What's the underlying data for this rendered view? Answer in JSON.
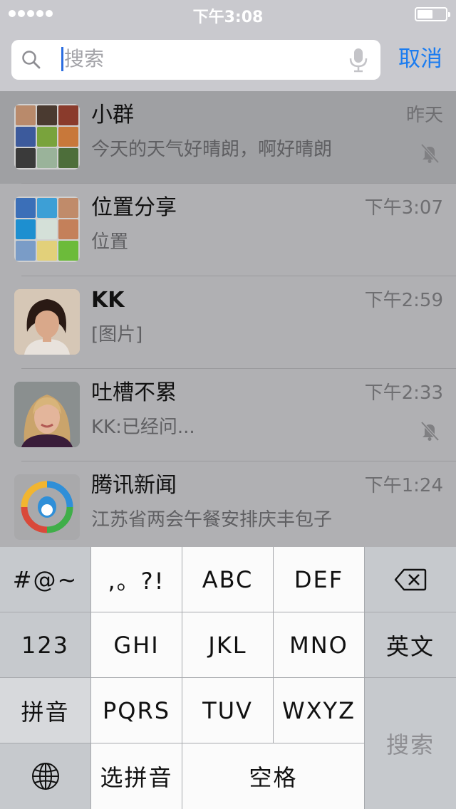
{
  "status_bar": {
    "time": "下午3:08",
    "signal_dots": 5,
    "battery_level": 0.55
  },
  "search": {
    "placeholder": "搜索",
    "cancel_label": "取消"
  },
  "chats": [
    {
      "name": "小群",
      "message": "今天的天气好晴朗，啊好晴朗",
      "time": "昨天",
      "muted": true,
      "avatar": "group-avatar",
      "tile_colors": [
        "#b98a6b",
        "#4a3a30",
        "#8a3b2c",
        "#3c5a9c",
        "#79a33c",
        "#c8783a",
        "#3a3a3a",
        "#9ab39a",
        "#4d6e3a"
      ]
    },
    {
      "name": "位置分享",
      "message": "位置",
      "time": "下午3:07",
      "muted": false,
      "avatar": "group-avatar",
      "tile_colors": [
        "#3b6fb8",
        "#3d9fd6",
        "#c08b6a",
        "#1d8fd0",
        "#d4e0d8",
        "#c4805a",
        "#7a9cc7",
        "#e2d07a",
        "#6cbb3a"
      ]
    },
    {
      "name": "KK",
      "message": "[图片]",
      "time": "下午2:59",
      "muted": false,
      "avatar": "person-avatar-kk"
    },
    {
      "name": "吐槽不累",
      "message": "KK:已经问...",
      "time": "下午2:33",
      "muted": true,
      "avatar": "person-avatar-blonde"
    },
    {
      "name": "腾讯新闻",
      "message": "江苏省两会午餐安排庆丰包子",
      "time": "下午1:24",
      "muted": false,
      "avatar": "tencent-news-logo"
    }
  ],
  "keyboard": {
    "symbols": "#@~",
    "numbers": "123",
    "pinyin": "拼音",
    "punct": ",。?!",
    "abc": "ABC",
    "def": "DEF",
    "ghi": "GHI",
    "jkl": "JKL",
    "mno": "MNO",
    "english": "英文",
    "pqrs": "PQRS",
    "tuv": "TUV",
    "wxyz": "WXYZ",
    "search": "搜索",
    "select_pinyin": "选拼音",
    "space": "空格",
    "icons": [
      "backspace-icon",
      "globe-icon"
    ]
  }
}
